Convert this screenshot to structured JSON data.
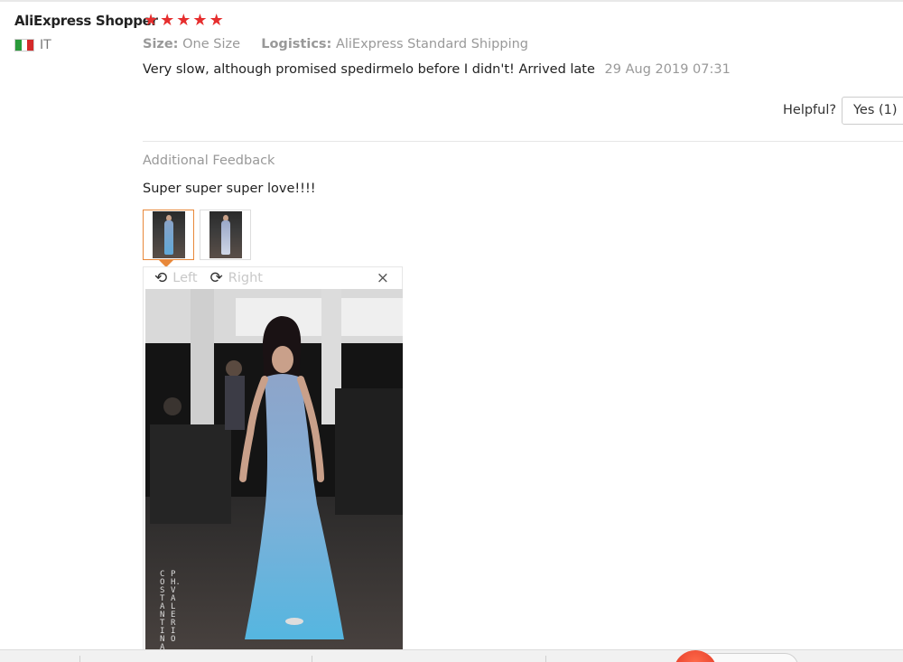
{
  "review": {
    "user_name": "AliExpress Shopper",
    "rating_stars": 5,
    "country_code": "IT",
    "flag_colors": [
      "#2a9a3a",
      "#ffffff",
      "#d42a2a"
    ],
    "size_label": "Size:",
    "size_value": "One Size",
    "logistics_label": "Logistics:",
    "logistics_value": "AliExpress Standard Shipping",
    "text": "Very slow, although promised spedirmelo before I didn't! Arrived late",
    "date": "29 Aug 2019 07:31",
    "helpful_label": "Helpful?",
    "yes_label": "Yes (1)"
  },
  "additional_feedback": {
    "title": "Additional Feedback",
    "text": "Super super super love!!!!"
  },
  "viewer": {
    "rotate_left_label": "Left",
    "rotate_right_label": "Right",
    "close_glyph": "×",
    "watermark_left": "COSTANTINA",
    "watermark_right": "PH.VALERIO"
  },
  "colors": {
    "star": "#e62e2e",
    "active_thumb_border": "#e8883a",
    "muted_text": "#999999"
  },
  "icons": {
    "star": "star-icon",
    "rotate_left": "rotate-left-icon",
    "rotate_right": "rotate-right-icon",
    "close": "close-icon"
  }
}
